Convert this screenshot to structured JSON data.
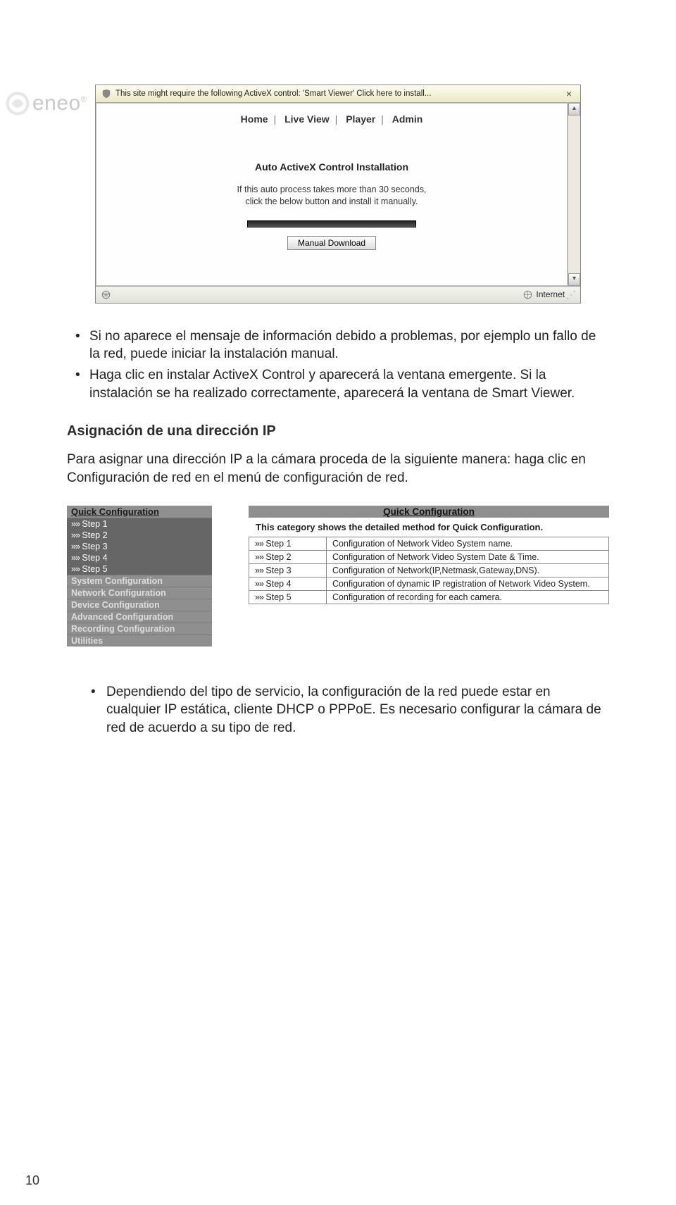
{
  "brand": {
    "name": "eneo",
    "trademark": "®"
  },
  "shot1": {
    "infobar_text": "This site might require the following ActiveX control: 'Smart Viewer' Click here to install...",
    "infobar_close": "×",
    "menu": {
      "home": "Home",
      "liveview": "Live View",
      "player": "Player",
      "admin": "Admin"
    },
    "title": "Auto ActiveX Control Installation",
    "msg_line1": "If this auto process takes more than 30 seconds,",
    "msg_line2": "click the below button and install it manually.",
    "button": "Manual Download",
    "status_zone": "Internet"
  },
  "bullets1": {
    "b1": "Si no aparece el mensaje de información debido a problemas, por ejemplo un fallo de la red, puede iniciar la instalación manual.",
    "b2": "Haga clic en instalar ActiveX Control y aparecerá la ventana emergente. Si la instalación se ha realizado correctamente, aparecerá la ventana de Smart Viewer."
  },
  "section_title": "Asignación de una dirección IP",
  "section_para": "Para asignar una dirección IP a la cámara proceda de la siguiente manera: haga clic en Configuración de red en el menú de configuración de red.",
  "side": {
    "quick": "Quick Configuration",
    "steps": [
      "Step 1",
      "Step 2",
      "Step 3",
      "Step 4",
      "Step 5"
    ],
    "sections": [
      "System Configuration",
      "Network Configuration",
      "Device Configuration",
      "Advanced Configuration",
      "Recording Configuration",
      "Utilities"
    ]
  },
  "qc": {
    "title": "Quick Configuration",
    "desc": "This category shows the detailed method for Quick Configuration.",
    "rows": [
      {
        "k": "Step 1",
        "v": "Configuration of Network Video System name."
      },
      {
        "k": "Step 2",
        "v": "Configuration of Network Video System Date & Time."
      },
      {
        "k": "Step 3",
        "v": "Configuration of Network(IP,Netmask,Gateway,DNS)."
      },
      {
        "k": "Step 4",
        "v": "Configuration of dynamic IP registration of Network Video System."
      },
      {
        "k": "Step 5",
        "v": "Configuration of recording for each camera."
      }
    ]
  },
  "bullets2": {
    "b1": "Dependiendo del tipo de servicio, la configuración de la red puede estar en cualquier IP estática, cliente DHCP o PPPoE. Es necesario configurar la cámara de red de acuerdo a su tipo de red."
  },
  "page_number": "10"
}
